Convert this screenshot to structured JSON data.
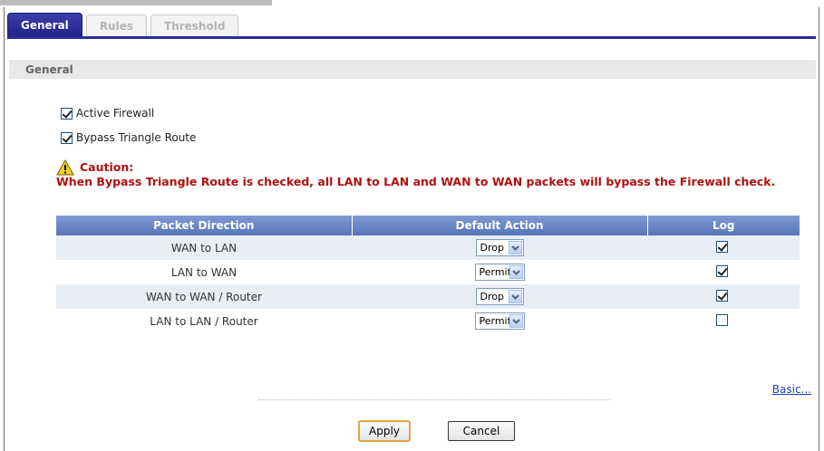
{
  "tabs": [
    {
      "label": "General",
      "active": true
    },
    {
      "label": "Rules",
      "active": false
    },
    {
      "label": "Threshold",
      "active": false
    }
  ],
  "section_title": "General",
  "options": {
    "active_firewall": {
      "label": "Active Firewall",
      "checked": true
    },
    "bypass_triangle": {
      "label": "Bypass Triangle Route",
      "checked": true
    }
  },
  "caution": {
    "title": "Caution:",
    "text": "When Bypass Triangle Route is checked, all LAN to LAN and WAN to WAN packets will bypass the Firewall check."
  },
  "table": {
    "headers": [
      "Packet Direction",
      "Default Action",
      "Log"
    ],
    "rows": [
      {
        "direction": "WAN to LAN",
        "action": "Drop",
        "log": true
      },
      {
        "direction": "LAN to WAN",
        "action": "Permit",
        "log": true
      },
      {
        "direction": "WAN to WAN / Router",
        "action": "Drop",
        "log": true
      },
      {
        "direction": "LAN to LAN / Router",
        "action": "Permit",
        "log": false
      }
    ]
  },
  "basic_link": "Basic...",
  "buttons": {
    "apply": "Apply",
    "cancel": "Cancel"
  },
  "colors": {
    "tab_active": "#2a2c95",
    "table_header": "#6783c4",
    "caution": "#b01010"
  }
}
